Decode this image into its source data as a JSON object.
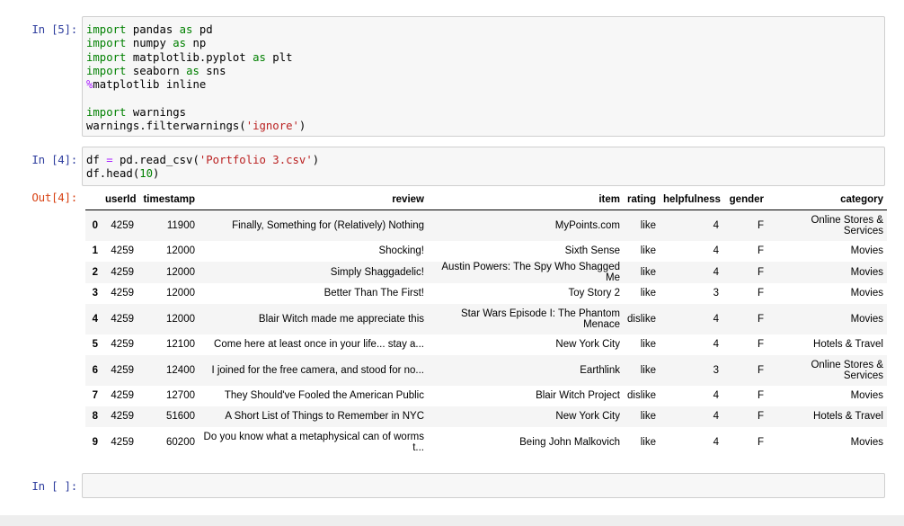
{
  "cells": [
    {
      "prompt": "In [5]:",
      "lines": [
        [
          {
            "t": "import",
            "c": "kw"
          },
          {
            "t": " pandas "
          },
          {
            "t": "as",
            "c": "kw"
          },
          {
            "t": " pd"
          }
        ],
        [
          {
            "t": "import",
            "c": "kw"
          },
          {
            "t": " numpy "
          },
          {
            "t": "as",
            "c": "kw"
          },
          {
            "t": " np"
          }
        ],
        [
          {
            "t": "import",
            "c": "kw"
          },
          {
            "t": " matplotlib.pyplot "
          },
          {
            "t": "as",
            "c": "kw"
          },
          {
            "t": " plt"
          }
        ],
        [
          {
            "t": "import",
            "c": "kw"
          },
          {
            "t": " seaborn "
          },
          {
            "t": "as",
            "c": "kw"
          },
          {
            "t": " sns"
          }
        ],
        [
          {
            "t": "%",
            "c": "op"
          },
          {
            "t": "matplotlib inline"
          }
        ],
        [],
        [
          {
            "t": "import",
            "c": "kw"
          },
          {
            "t": " warnings"
          }
        ],
        [
          {
            "t": "warnings.filterwarnings("
          },
          {
            "t": "'ignore'",
            "c": "str"
          },
          {
            "t": ")"
          }
        ]
      ]
    },
    {
      "prompt": "In [4]:",
      "lines": [
        [
          {
            "t": "df "
          },
          {
            "t": "=",
            "c": "op"
          },
          {
            "t": " pd.read_csv("
          },
          {
            "t": "'Portfolio 3.csv'",
            "c": "str"
          },
          {
            "t": ")"
          }
        ],
        [
          {
            "t": "df.head("
          },
          {
            "t": "10",
            "c": "num"
          },
          {
            "t": ")"
          }
        ]
      ]
    },
    {
      "prompt": "In [ ]:",
      "lines": []
    }
  ],
  "output": {
    "prompt": "Out[4]:",
    "columns": [
      "",
      "userId",
      "timestamp",
      "review",
      "item",
      "rating",
      "helpfulness",
      "gender",
      "category"
    ],
    "rows": [
      [
        "0",
        "4259",
        "11900",
        "Finally, Something for (Relatively) Nothing",
        "MyPoints.com",
        "like",
        "4",
        "F",
        "Online Stores & Services"
      ],
      [
        "1",
        "4259",
        "12000",
        "Shocking!",
        "Sixth Sense",
        "like",
        "4",
        "F",
        "Movies"
      ],
      [
        "2",
        "4259",
        "12000",
        "Simply Shaggadelic!",
        "Austin Powers: The Spy Who Shagged Me",
        "like",
        "4",
        "F",
        "Movies"
      ],
      [
        "3",
        "4259",
        "12000",
        "Better Than The First!",
        "Toy Story 2",
        "like",
        "3",
        "F",
        "Movies"
      ],
      [
        "4",
        "4259",
        "12000",
        "Blair Witch made me appreciate this",
        "Star Wars Episode I: The Phantom Menace",
        "dislike",
        "4",
        "F",
        "Movies"
      ],
      [
        "5",
        "4259",
        "12100",
        "Come here at least once in your life... stay a...",
        "New York City",
        "like",
        "4",
        "F",
        "Hotels & Travel"
      ],
      [
        "6",
        "4259",
        "12400",
        "I joined for the free camera, and stood for no...",
        "Earthlink",
        "like",
        "3",
        "F",
        "Online Stores & Services"
      ],
      [
        "7",
        "4259",
        "12700",
        "They Should've Fooled the American Public",
        "Blair Witch Project",
        "dislike",
        "4",
        "F",
        "Movies"
      ],
      [
        "8",
        "4259",
        "51600",
        "A Short List of Things to Remember in NYC",
        "New York City",
        "like",
        "4",
        "F",
        "Hotels & Travel"
      ],
      [
        "9",
        "4259",
        "60200",
        "Do you know what a metaphysical can of worms t...",
        "Being John Malkovich",
        "like",
        "4",
        "F",
        "Movies"
      ]
    ]
  }
}
